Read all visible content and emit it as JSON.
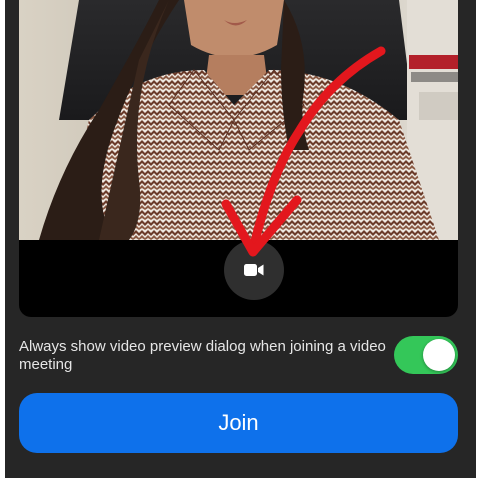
{
  "preview": {
    "camera_icon": "video-camera-icon"
  },
  "annotation": {
    "arrow_color": "#e3171d"
  },
  "preference": {
    "label": "Always show video preview dialog when joining a video meeting",
    "toggle_on": true,
    "toggle_color": "#34c759"
  },
  "join": {
    "label": "Join",
    "color": "#0e71eb"
  }
}
